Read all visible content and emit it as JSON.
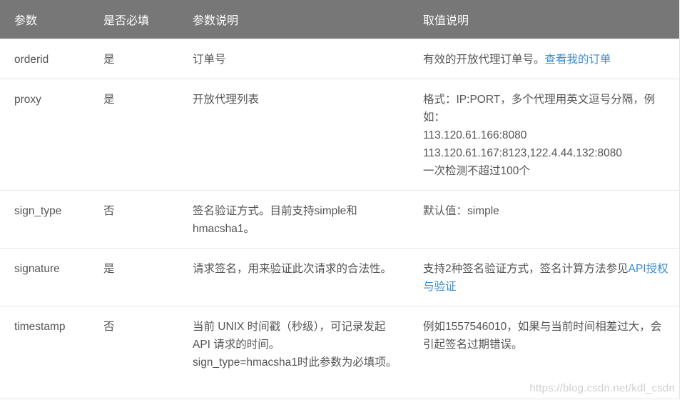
{
  "headers": {
    "param": "参数",
    "required": "是否必填",
    "desc": "参数说明",
    "value": "取值说明"
  },
  "rows": [
    {
      "name": "orderid",
      "required": "是",
      "desc": "订单号",
      "value_text": "有效的开放代理订单号。",
      "value_link": "查看我的订单"
    },
    {
      "name": "proxy",
      "required": "是",
      "desc": "开放代理列表",
      "value_lines": [
        "格式：IP:PORT，多个代理用英文逗号分隔，例如：",
        "113.120.61.166:8080",
        "113.120.61.167:8123,122.4.44.132:8080",
        "一次检测不超过100个"
      ]
    },
    {
      "name": "sign_type",
      "required": "否",
      "desc": "签名验证方式。目前支持simple和hmacsha1。",
      "value_text": "默认值：simple"
    },
    {
      "name": "signature",
      "required": "是",
      "desc": "请求签名，用来验证此次请求的合法性。",
      "value_text": "支持2种签名验证方式，签名计算方法参见",
      "value_link": "API授权与验证"
    },
    {
      "name": "timestamp",
      "required": "否",
      "desc_lines": [
        "当前 UNIX 时间戳（秒级），可记录发起 API 请求的时间。",
        "sign_type=hmacsha1时此参数为必填项。"
      ],
      "value_text": "例如1557546010，如果与当前时间相差过大，会引起签名过期错误。"
    }
  ],
  "watermark": "https://blog.csdn.net/kdl_csdn",
  "colors": {
    "header_bg": "#777777",
    "required_yes": "#e07500",
    "link": "#3d8fd1"
  }
}
